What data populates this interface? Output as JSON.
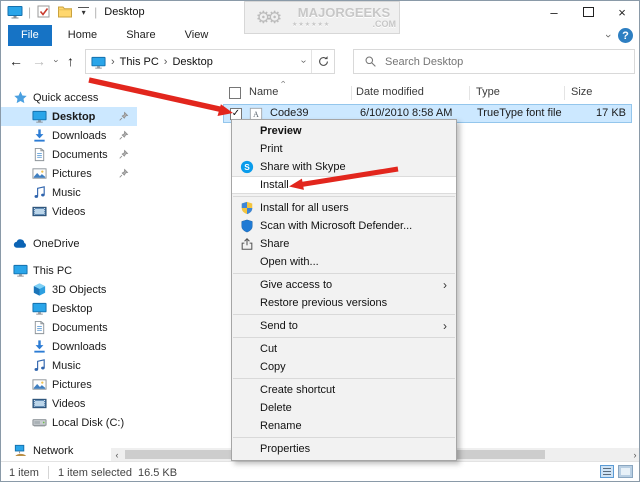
{
  "titlebar": {
    "title": "Desktop",
    "watermark": {
      "line1": "MAJORGEEKS",
      "stars": "★★★★★★",
      "line2": ".COM"
    }
  },
  "ribbon": {
    "tabs": [
      {
        "label": "File",
        "active": true
      },
      {
        "label": "Home"
      },
      {
        "label": "Share"
      },
      {
        "label": "View"
      }
    ]
  },
  "toolbar": {
    "breadcrumb": {
      "segments": [
        "This PC",
        "Desktop"
      ]
    },
    "search": {
      "placeholder": "Search Desktop"
    }
  },
  "sidebar": {
    "items": [
      {
        "label": "Quick access",
        "icon": "star",
        "level": 0
      },
      {
        "label": "Desktop",
        "icon": "monitor",
        "level": 1,
        "pinned": true,
        "selected": true
      },
      {
        "label": "Downloads",
        "icon": "download",
        "level": 1,
        "pinned": true
      },
      {
        "label": "Documents",
        "icon": "document",
        "level": 1,
        "pinned": true
      },
      {
        "label": "Pictures",
        "icon": "picture",
        "level": 1,
        "pinned": true
      },
      {
        "label": "Music",
        "icon": "music",
        "level": 1
      },
      {
        "label": "Videos",
        "icon": "video",
        "level": 1
      },
      {
        "label": "OneDrive",
        "icon": "cloud",
        "level": 0,
        "gap_before": 13
      },
      {
        "label": "This PC",
        "icon": "monitor",
        "level": 0,
        "gap_before": 8
      },
      {
        "label": "3D Objects",
        "icon": "cube",
        "level": 1
      },
      {
        "label": "Desktop",
        "icon": "monitor",
        "level": 1
      },
      {
        "label": "Documents",
        "icon": "document",
        "level": 1
      },
      {
        "label": "Downloads",
        "icon": "download",
        "level": 1
      },
      {
        "label": "Music",
        "icon": "music",
        "level": 1
      },
      {
        "label": "Pictures",
        "icon": "picture",
        "level": 1
      },
      {
        "label": "Videos",
        "icon": "video",
        "level": 1
      },
      {
        "label": "Local Disk (C:)",
        "icon": "disk",
        "level": 1
      },
      {
        "label": "Network",
        "icon": "network",
        "level": 0,
        "gap_before": 9
      }
    ]
  },
  "list": {
    "columns": [
      {
        "label": "Name"
      },
      {
        "label": "Date modified"
      },
      {
        "label": "Type"
      },
      {
        "label": "Size"
      }
    ],
    "sort": {
      "column": "Name",
      "direction": "asc"
    },
    "rows": [
      {
        "name": "Code39",
        "checked": true,
        "selected": true,
        "icon": "fontfile",
        "date_modified": "6/10/2010 8:58 AM",
        "type": "TrueType font file",
        "size": "17 KB"
      }
    ]
  },
  "context_menu": {
    "items": [
      {
        "label": "Preview",
        "bold": true
      },
      {
        "label": "Print"
      },
      {
        "label": "Share with Skype",
        "icon": "skype"
      },
      {
        "label": "Install",
        "highlighted": true,
        "separator_after": true
      },
      {
        "label": "Install for all users",
        "icon": "uac-shield"
      },
      {
        "label": "Scan with Microsoft Defender...",
        "icon": "defender-shield"
      },
      {
        "label": "Share",
        "icon": "share"
      },
      {
        "label": "Open with...",
        "separator_after": true
      },
      {
        "label": "Give access to",
        "submenu": true
      },
      {
        "label": "Restore previous versions",
        "separator_after": true
      },
      {
        "label": "Send to",
        "submenu": true,
        "separator_after": true
      },
      {
        "label": "Cut"
      },
      {
        "label": "Copy",
        "separator_after": true
      },
      {
        "label": "Create shortcut"
      },
      {
        "label": "Delete"
      },
      {
        "label": "Rename",
        "separator_after": true
      },
      {
        "label": "Properties"
      }
    ]
  },
  "statusbar": {
    "items_count": "1 item",
    "selection": "1 item selected",
    "selection_size": "16.5 KB"
  },
  "icons": {
    "back": "←",
    "forward": "→",
    "up": "↑",
    "chevron-right": "›",
    "chevron-left": "‹",
    "dropdown": "▾",
    "minimize": "–",
    "close": "×",
    "help": "?",
    "check": "✓",
    "gear": "⚙"
  },
  "colors": {
    "accent": "#1673c5",
    "selection_bg": "#cce8ff",
    "selection_border": "#94c6ec",
    "arrow_red": "#e2261d",
    "menu_bg": "#f2f2f2"
  }
}
